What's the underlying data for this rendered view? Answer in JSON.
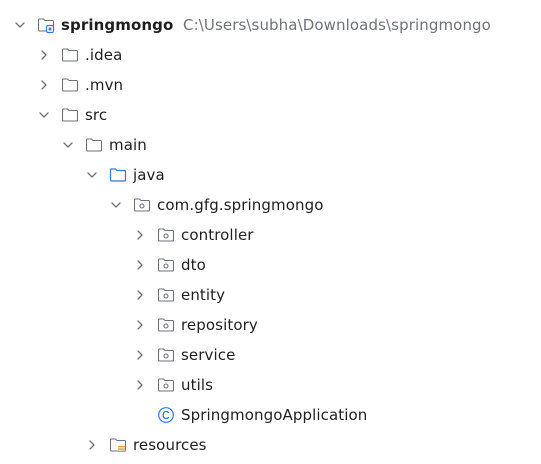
{
  "project": {
    "name": "springmongo",
    "path": "C:\\Users\\subha\\Downloads\\springmongo"
  },
  "tree": {
    "idea": ".idea",
    "mvn": ".mvn",
    "src": "src",
    "main": "main",
    "java": "java",
    "package": "com.gfg.springmongo",
    "controller": "controller",
    "dto": "dto",
    "entity": "entity",
    "repository": "repository",
    "service": "service",
    "utils": "utils",
    "app_class": "SpringmongoApplication",
    "resources": "resources"
  },
  "colors": {
    "chevron": "#6c707e",
    "folder_stroke": "#6c707e",
    "source_folder": "#3574f0",
    "module_dot": "#3574f0",
    "class_icon": "#3574f0",
    "resources_bars": "#e0a33c",
    "path_text": "#6f737a"
  },
  "icons": {
    "expanded": "chevron-down-icon",
    "collapsed": "chevron-right-icon",
    "module": "module-folder-icon",
    "folder": "folder-icon",
    "source_root": "source-folder-icon",
    "package": "package-folder-icon",
    "class": "class-icon",
    "resources_root": "resources-folder-icon"
  }
}
